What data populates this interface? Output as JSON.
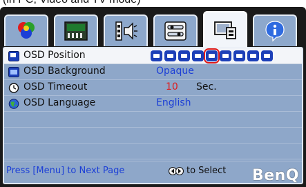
{
  "caption": "(in PC, Video and TV mode)",
  "tabs": [
    {
      "icon": "color-wheel-icon",
      "active": false
    },
    {
      "icon": "picture-adjust-icon",
      "active": false
    },
    {
      "icon": "audio-input-icon",
      "active": false
    },
    {
      "icon": "setup-icon",
      "active": false
    },
    {
      "icon": "osd-settings-icon",
      "active": true
    },
    {
      "icon": "information-icon",
      "active": false
    }
  ],
  "menu": {
    "osd_position": {
      "label": "OSD Position",
      "icon": "osd-position-icon",
      "positions": 9,
      "selected_index": 4
    },
    "osd_background": {
      "label": "OSD Background",
      "icon": "osd-background-icon",
      "value": "Opaque"
    },
    "osd_timeout": {
      "label": "OSD Timeout",
      "icon": "clock-icon",
      "value": "10",
      "unit": "Sec."
    },
    "osd_language": {
      "label": "OSD Language",
      "icon": "globe-icon",
      "value": "English"
    }
  },
  "footer": {
    "hint": "Press [Menu] to Next Page",
    "select_label": "to Select",
    "arrows_icon": "left-right-arrows-icon"
  },
  "brand": "BenQ",
  "colors": {
    "accent_blue": "#1c3fd6",
    "highlight_red": "#e01b1b",
    "panel": "#8ea7c9"
  }
}
